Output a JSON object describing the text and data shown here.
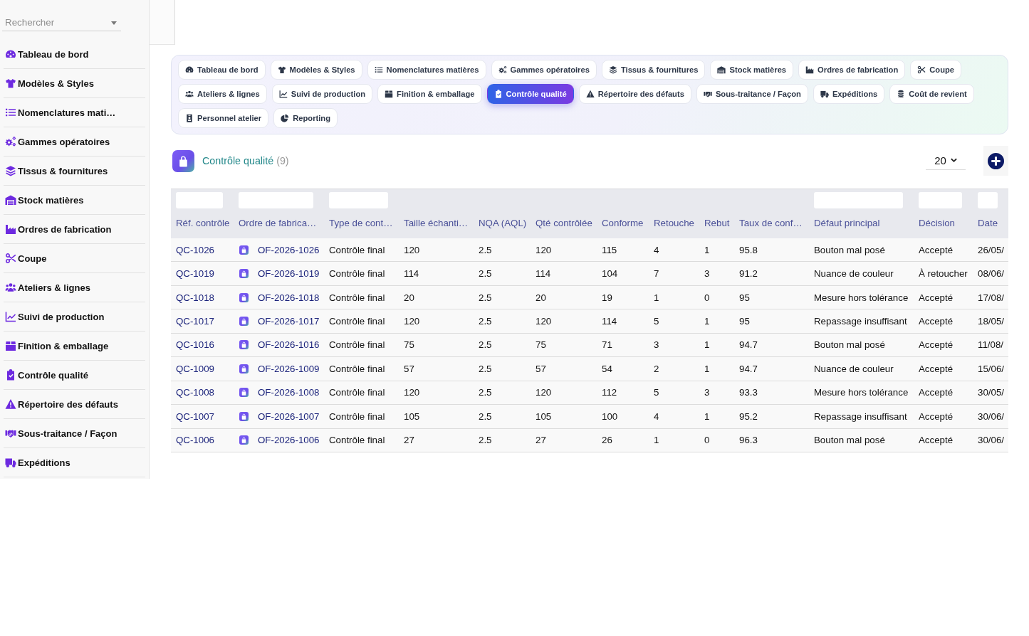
{
  "sidebar": {
    "search": {
      "placeholder": "Rechercher"
    },
    "items": [
      {
        "label": "Tableau de bord"
      },
      {
        "label": "Modèles & Styles"
      },
      {
        "label": "Nomenclatures mati…"
      },
      {
        "label": "Gammes opératoires"
      },
      {
        "label": "Tissus & fournitures"
      },
      {
        "label": "Stock matières"
      },
      {
        "label": "Ordres de fabrication"
      },
      {
        "label": "Coupe"
      },
      {
        "label": "Ateliers & lignes"
      },
      {
        "label": "Suivi de production"
      },
      {
        "label": "Finition & emballage"
      },
      {
        "label": "Contrôle qualité"
      },
      {
        "label": "Répertoire des défauts"
      },
      {
        "label": "Sous-traitance / Façon"
      },
      {
        "label": "Expéditions"
      }
    ]
  },
  "tabs": [
    {
      "label": "Tableau de bord",
      "selected": false
    },
    {
      "label": "Modèles & Styles",
      "selected": false
    },
    {
      "label": "Nomenclatures matières",
      "selected": false
    },
    {
      "label": "Gammes opératoires",
      "selected": false
    },
    {
      "label": "Tissus & fournitures",
      "selected": false
    },
    {
      "label": "Stock matières",
      "selected": false
    },
    {
      "label": "Ordres de fabrication",
      "selected": false
    },
    {
      "label": "Coupe",
      "selected": false
    },
    {
      "label": "Ateliers & lignes",
      "selected": false
    },
    {
      "label": "Suivi de production",
      "selected": false
    },
    {
      "label": "Finition & emballage",
      "selected": false
    },
    {
      "label": "Contrôle qualité",
      "selected": true
    },
    {
      "label": "Répertoire des défauts",
      "selected": false
    },
    {
      "label": "Sous-traitance / Façon",
      "selected": false
    },
    {
      "label": "Expéditions",
      "selected": false
    },
    {
      "label": "Coût de revient",
      "selected": false
    },
    {
      "label": "Personnel atelier",
      "selected": false
    },
    {
      "label": "Reporting",
      "selected": false
    }
  ],
  "header": {
    "title": "Contrôle qualité",
    "count": "(9)",
    "page_size": "20"
  },
  "table": {
    "columns": [
      {
        "label": "Réf. contrôle",
        "kind": "link",
        "filterable": true
      },
      {
        "label": "Ordre de fabrica…",
        "kind": "order",
        "filterable": true
      },
      {
        "label": "Type de cont…",
        "kind": "text",
        "filterable": true
      },
      {
        "label": "Taille échanti…",
        "kind": "text",
        "filterable": false
      },
      {
        "label": "NQA (AQL)",
        "kind": "text",
        "filterable": false
      },
      {
        "label": "Qté contrôlée",
        "kind": "text",
        "filterable": false
      },
      {
        "label": "Conforme",
        "kind": "text",
        "filterable": false
      },
      {
        "label": "Retouche",
        "kind": "text",
        "filterable": false
      },
      {
        "label": "Rebut",
        "kind": "text",
        "filterable": false
      },
      {
        "label": "Taux de conf…",
        "kind": "text",
        "filterable": false
      },
      {
        "label": "Défaut principal",
        "kind": "text",
        "filterable": true
      },
      {
        "label": "Décision",
        "kind": "text",
        "filterable": true
      },
      {
        "label": "Date",
        "kind": "text",
        "filterable": true
      }
    ],
    "rows": [
      {
        "cells": [
          "QC-1026",
          "OF-2026-1026",
          "Contrôle final",
          "120",
          "2.5",
          "120",
          "115",
          "4",
          "1",
          "95.8",
          "Bouton mal posé",
          "Accepté",
          "26/05/"
        ]
      },
      {
        "cells": [
          "QC-1019",
          "OF-2026-1019",
          "Contrôle final",
          "114",
          "2.5",
          "114",
          "104",
          "7",
          "3",
          "91.2",
          "Nuance de couleur",
          "À retoucher",
          "08/06/"
        ]
      },
      {
        "cells": [
          "QC-1018",
          "OF-2026-1018",
          "Contrôle final",
          "20",
          "2.5",
          "20",
          "19",
          "1",
          "0",
          "95",
          "Mesure hors tolérance",
          "Accepté",
          "17/08/"
        ]
      },
      {
        "cells": [
          "QC-1017",
          "OF-2026-1017",
          "Contrôle final",
          "120",
          "2.5",
          "120",
          "114",
          "5",
          "1",
          "95",
          "Repassage insuffisant",
          "Accepté",
          "18/05/"
        ]
      },
      {
        "cells": [
          "QC-1016",
          "OF-2026-1016",
          "Contrôle final",
          "75",
          "2.5",
          "75",
          "71",
          "3",
          "1",
          "94.7",
          "Bouton mal posé",
          "Accepté",
          "11/08/"
        ]
      },
      {
        "cells": [
          "QC-1009",
          "OF-2026-1009",
          "Contrôle final",
          "57",
          "2.5",
          "57",
          "54",
          "2",
          "1",
          "94.7",
          "Nuance de couleur",
          "Accepté",
          "15/06/"
        ]
      },
      {
        "cells": [
          "QC-1008",
          "OF-2026-1008",
          "Contrôle final",
          "120",
          "2.5",
          "120",
          "112",
          "5",
          "3",
          "93.3",
          "Mesure hors tolérance",
          "Accepté",
          "30/05/"
        ]
      },
      {
        "cells": [
          "QC-1007",
          "OF-2026-1007",
          "Contrôle final",
          "105",
          "2.5",
          "105",
          "100",
          "4",
          "1",
          "95.2",
          "Repassage insuffisant",
          "Accepté",
          "30/06/"
        ]
      },
      {
        "cells": [
          "QC-1006",
          "OF-2026-1006",
          "Contrôle final",
          "27",
          "2.5",
          "27",
          "26",
          "1",
          "0",
          "96.3",
          "Bouton mal posé",
          "Accepté",
          "30/06/"
        ]
      }
    ]
  }
}
